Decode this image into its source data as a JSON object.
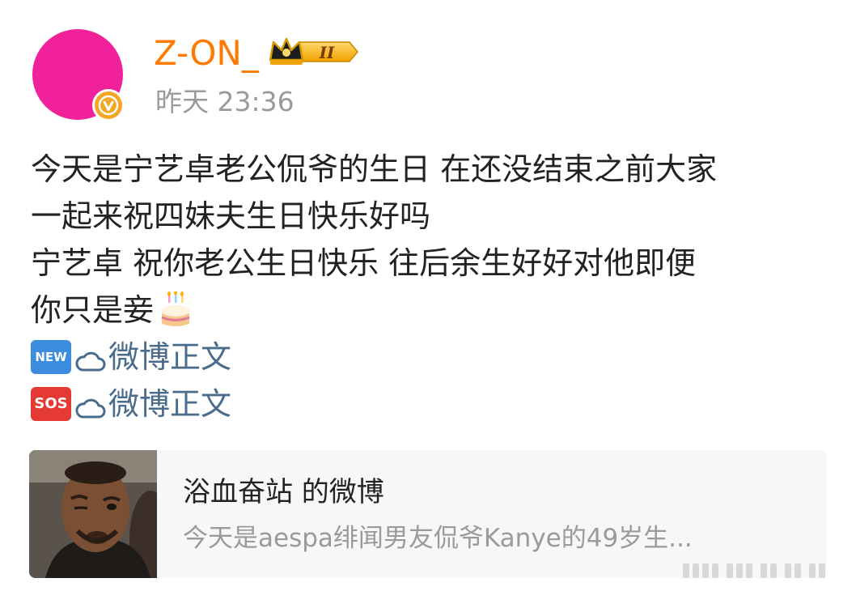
{
  "post": {
    "username": "Z-ON_",
    "level_badge": "II",
    "timestamp": "昨天 23:36",
    "lines": [
      "今天是宁艺卓老公侃爷的生日 在还没结束之前大家",
      "一起来祝四妹夫生日快乐好吗",
      "宁艺卓 祝你老公生日快乐 往后余生好好对他即便",
      "你只是妾"
    ],
    "tags": [
      {
        "emoji": "NEW",
        "text": "微博正文"
      },
      {
        "emoji": "SOS",
        "text": "微博正文"
      }
    ]
  },
  "card": {
    "title": "浴血奋站 的微博",
    "subtitle": "今天是aespa绯闻男友侃爷Kanye的49岁生..."
  },
  "colors": {
    "avatar": "#f0219b",
    "username": "#ff7a00",
    "timestamp": "#9a9a9a",
    "link": "#4a6c8c",
    "verified_badge": "#f5a623"
  },
  "icons": [
    "verified-icon",
    "crown-icon",
    "cake-icon",
    "new-emoji-icon",
    "sos-emoji-icon",
    "cloud-icon"
  ]
}
